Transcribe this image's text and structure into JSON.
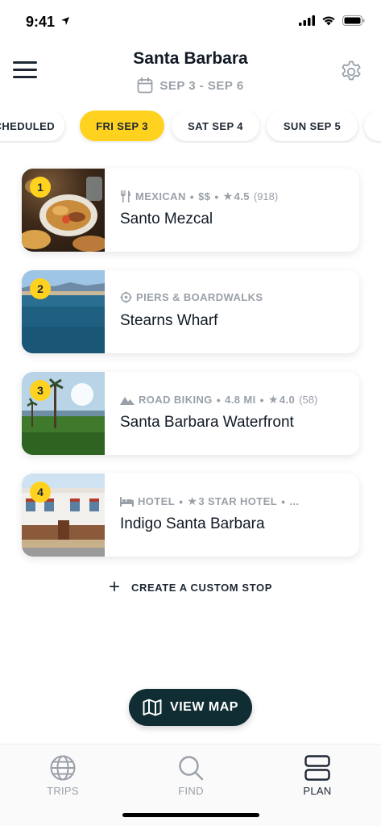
{
  "status_bar": {
    "time": "9:41"
  },
  "header": {
    "title": "Santa Barbara",
    "date_range": "SEP 3 - SEP 6"
  },
  "day_tabs": [
    {
      "label": "SCHEDULED",
      "active": false
    },
    {
      "label": "FRI SEP 3",
      "active": true
    },
    {
      "label": "SAT SEP 4",
      "active": false
    },
    {
      "label": "SUN SEP 5",
      "active": false
    }
  ],
  "stops": [
    {
      "number": "1",
      "category": "MEXICAN",
      "category_icon": "fork-knife-icon",
      "price": "$$",
      "rating": "4.5",
      "review_count": "(918)",
      "name": "Santo Mezcal"
    },
    {
      "number": "2",
      "category": "PIERS & BOARDWALKS",
      "category_icon": "pier-icon",
      "name": "Stearns Wharf"
    },
    {
      "number": "3",
      "category": "ROAD BIKING",
      "category_icon": "mountain-icon",
      "distance": "4.8 MI",
      "rating": "4.0",
      "review_count": "(58)",
      "name": "Santa Barbara Waterfront"
    },
    {
      "number": "4",
      "category": "HOTEL",
      "category_icon": "bed-icon",
      "hotel_class": "3 STAR HOTEL",
      "more": "...",
      "name": "Indigo Santa Barbara"
    }
  ],
  "custom_stop": {
    "plus": "+",
    "label": "CREATE A CUSTOM STOP"
  },
  "view_map": {
    "label": "VIEW MAP"
  },
  "bottom_nav": [
    {
      "label": "TRIPS",
      "icon": "globe-icon",
      "active": false
    },
    {
      "label": "FIND",
      "icon": "search-icon",
      "active": false
    },
    {
      "label": "PLAN",
      "icon": "plan-icon",
      "active": true
    }
  ],
  "colors": {
    "accent_yellow": "#ffd21f",
    "dark_teal": "#0f2d33",
    "text_dark": "#1d2733",
    "text_muted": "#9aa0a8"
  }
}
